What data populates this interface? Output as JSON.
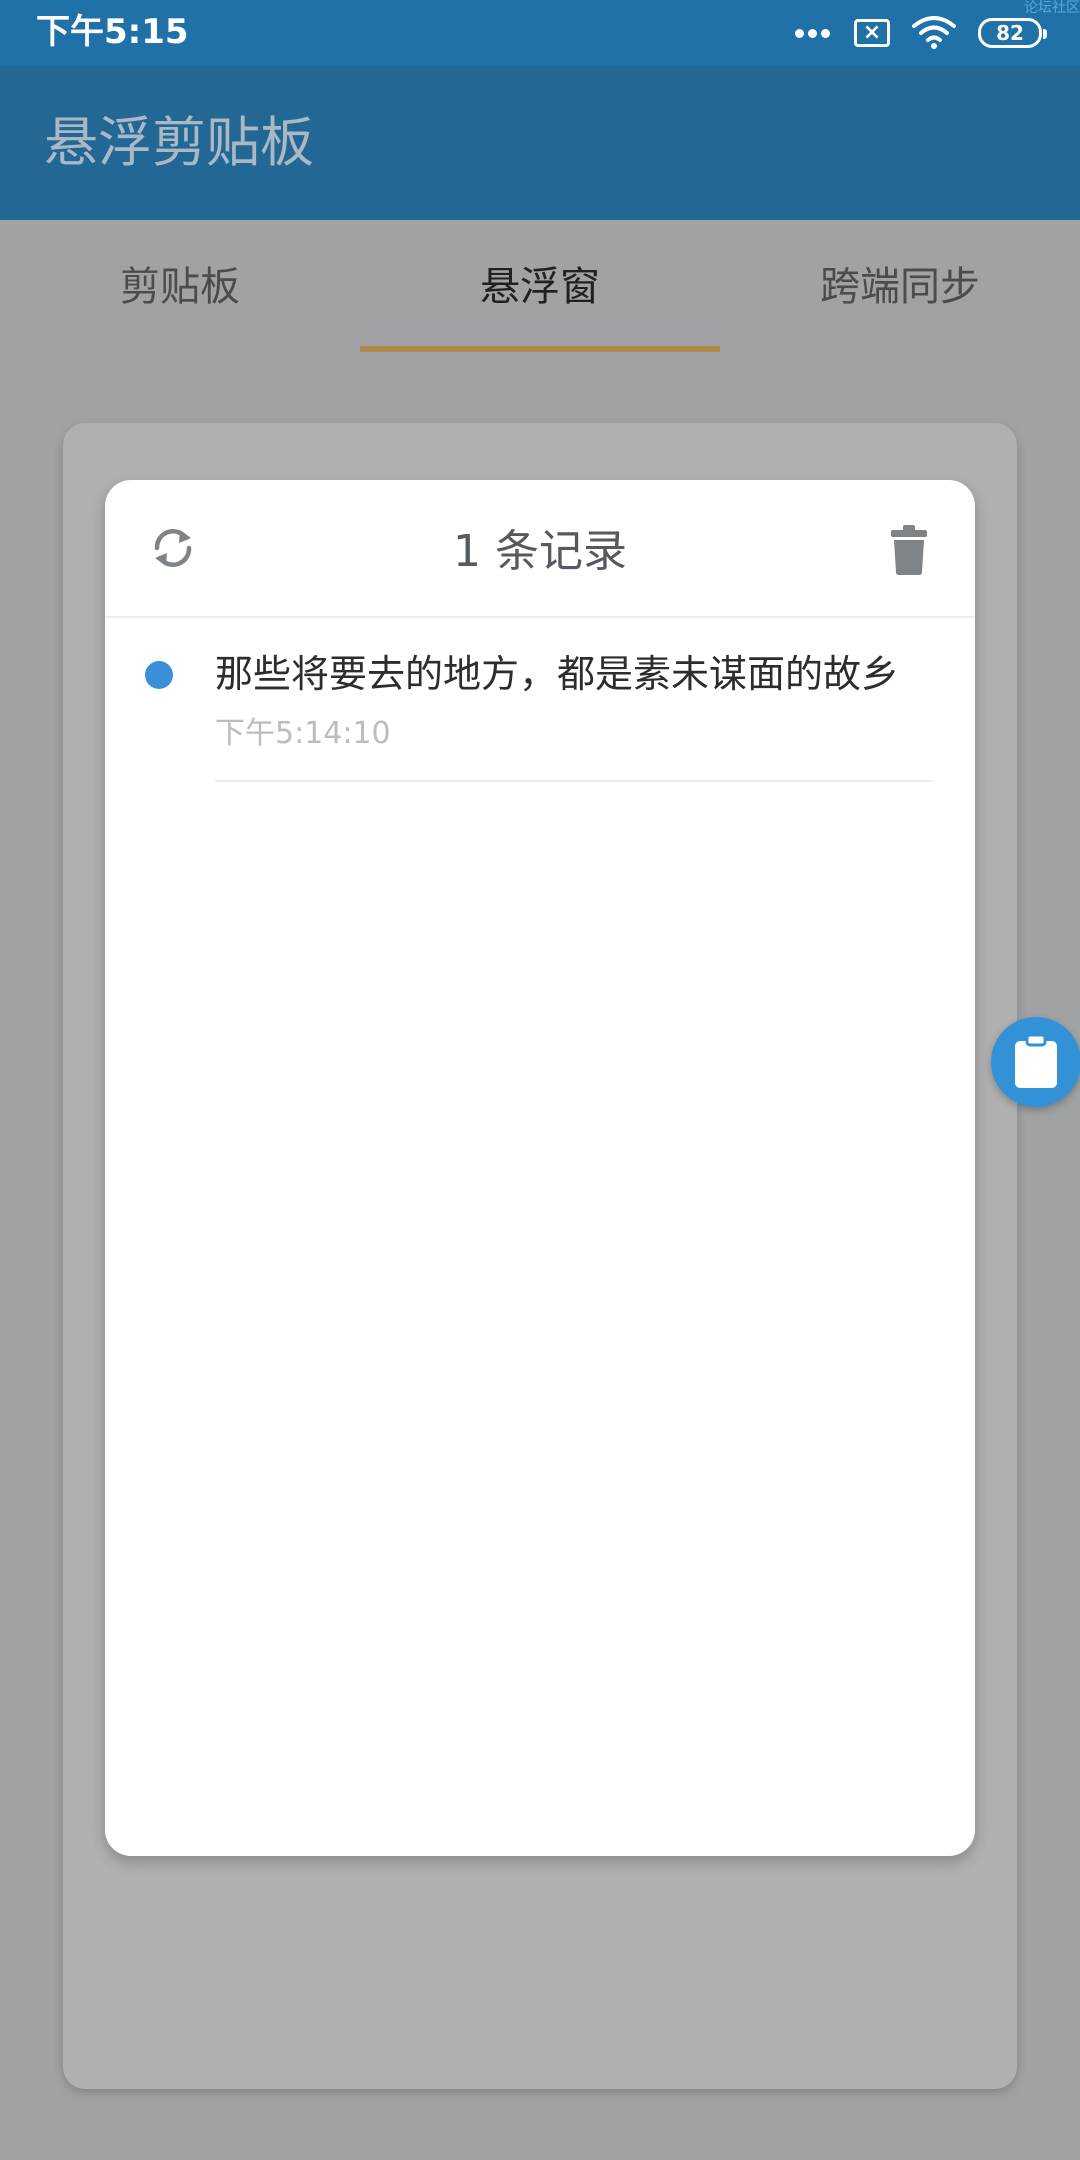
{
  "status_bar": {
    "time": "下午5:15",
    "battery": "82",
    "icons": [
      "more-dots-icon",
      "sim-x-icon",
      "wifi-icon",
      "battery-icon"
    ],
    "watermark": "论坛社区"
  },
  "app_bar": {
    "title": "悬浮剪贴板"
  },
  "tabs": [
    {
      "label": "剪贴板",
      "active": false
    },
    {
      "label": "悬浮窗",
      "active": true
    },
    {
      "label": "跨端同步",
      "active": false
    }
  ],
  "card": {
    "record_count": "1 条记录",
    "refresh_icon": "refresh-icon",
    "delete_icon": "trash-icon",
    "items": [
      {
        "text": "那些将要去的地方，都是素未谋面的故乡",
        "time": "下午5:14:10"
      }
    ]
  },
  "float_button": {
    "icon": "clipboard-icon"
  },
  "colors": {
    "status_bar": "#2071a8",
    "app_bar": "#236895",
    "tab_indicator": "#b08a4c",
    "dot": "#3a8fd8",
    "float_bubble": "#3391d8"
  }
}
